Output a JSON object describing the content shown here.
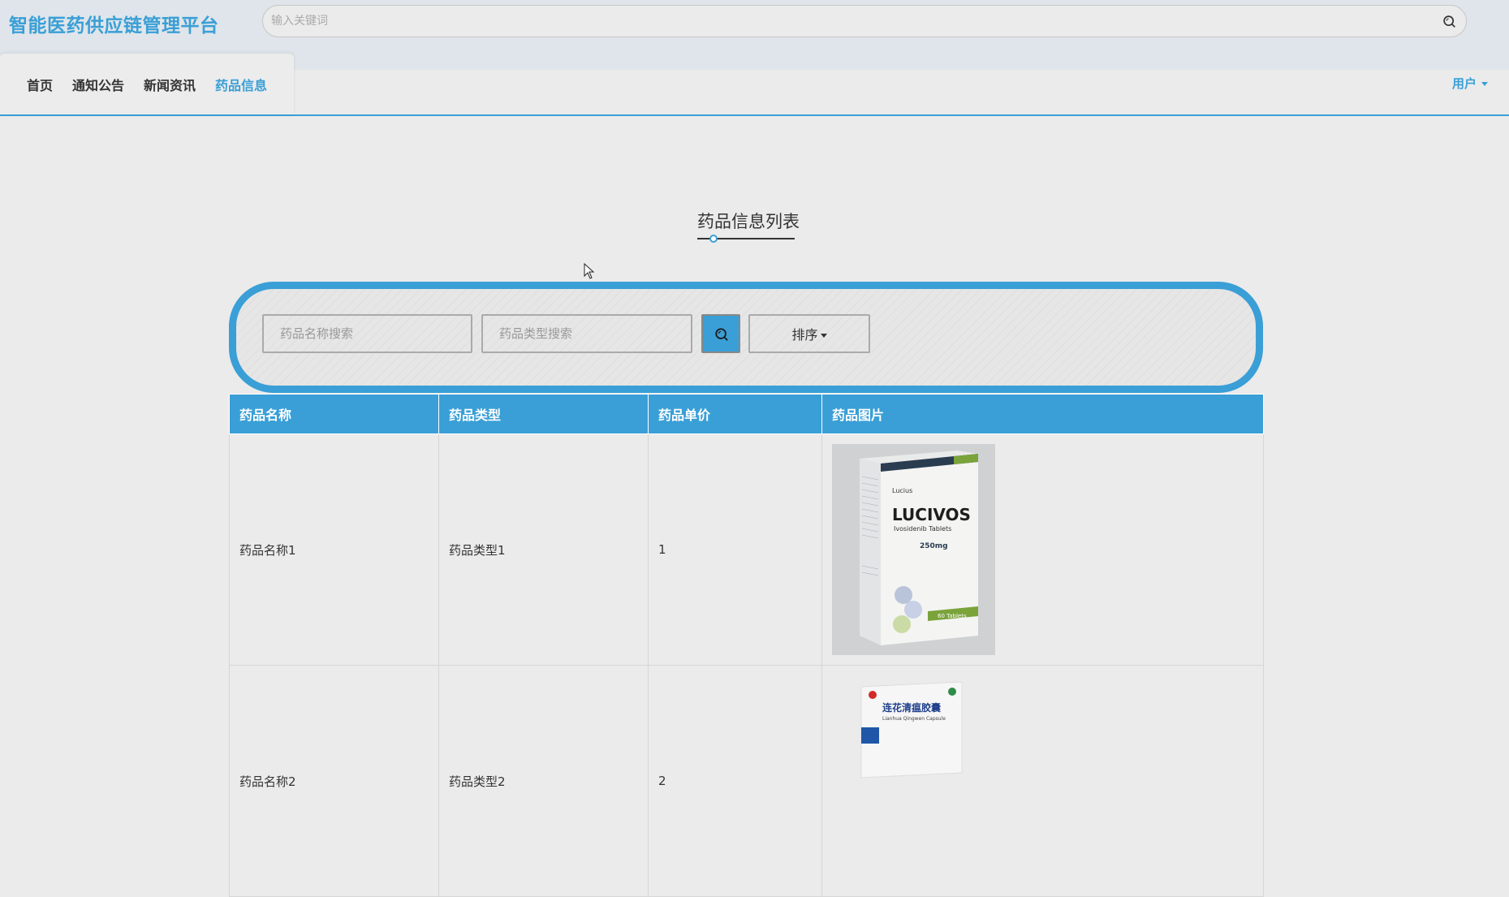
{
  "header": {
    "brand": "智能医药供应链管理平台",
    "search_placeholder": "输入关键词",
    "search_icon": "search-icon"
  },
  "nav": {
    "items": [
      {
        "label": "首页",
        "active": false
      },
      {
        "label": "通知公告",
        "active": false
      },
      {
        "label": "新闻资讯",
        "active": false
      },
      {
        "label": "药品信息",
        "active": true
      }
    ],
    "user_label": "用户"
  },
  "page": {
    "title": "药品信息列表"
  },
  "filters": {
    "name_placeholder": "药品名称搜索",
    "type_placeholder": "药品类型搜索",
    "search_icon": "search-icon",
    "sort_label": "排序"
  },
  "table": {
    "headers": [
      "药品名称",
      "药品类型",
      "药品单价",
      "药品图片"
    ],
    "rows": [
      {
        "name": "药品名称1",
        "type": "药品类型1",
        "price": "1",
        "image": {
          "brand": "Lucius",
          "product": "LUCIVOS",
          "subtitle": "Ivosidenib Tablets",
          "dose": "250mg",
          "count": "60 Tablets"
        }
      },
      {
        "name": "药品名称2",
        "type": "药品类型2",
        "price": "2",
        "image": {
          "product": "连花清瘟胶囊",
          "subtitle": "Lianhua Qingwen Capsule"
        }
      }
    ]
  },
  "colors": {
    "accent": "#3a9fd6",
    "background": "#ebebeb",
    "header_bg": "#dfe5ea"
  }
}
